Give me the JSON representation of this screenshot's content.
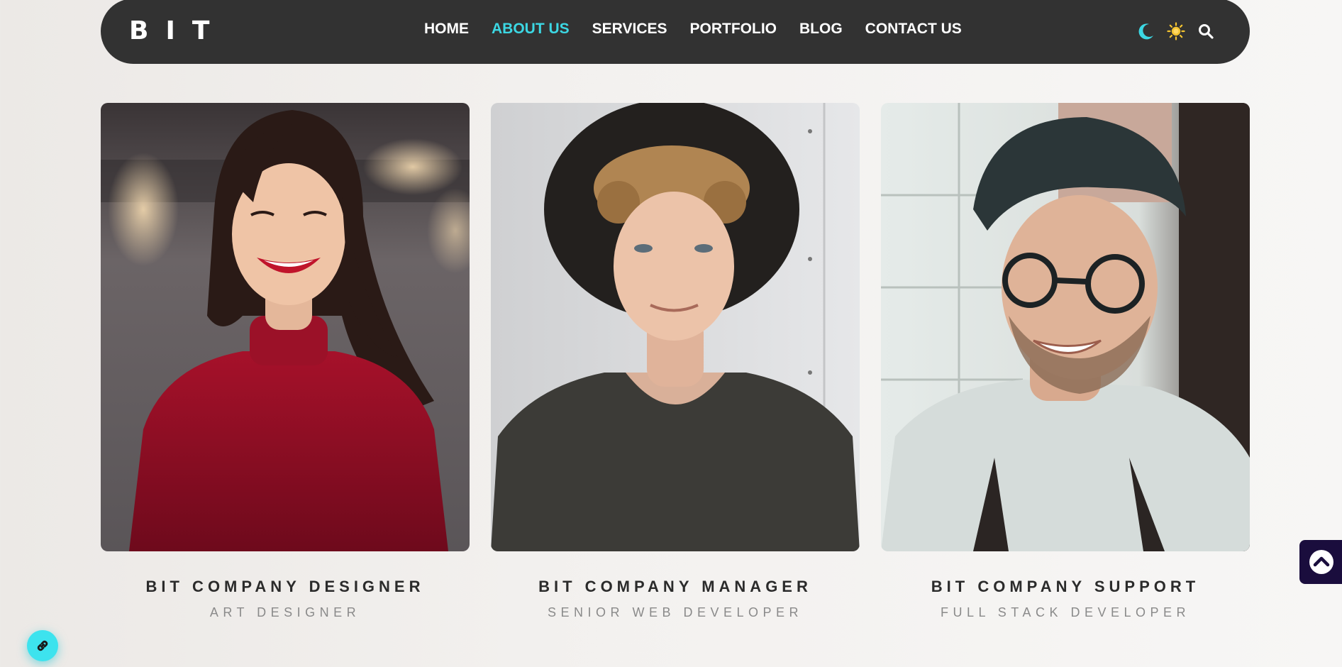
{
  "header": {
    "logo_letters": [
      "B",
      "I",
      "T"
    ],
    "nav": [
      {
        "label": "HOME",
        "active": false
      },
      {
        "label": "ABOUT US",
        "active": true
      },
      {
        "label": "SERVICES",
        "active": false
      },
      {
        "label": "PORTFOLIO",
        "active": false
      },
      {
        "label": "BLOG",
        "active": false
      },
      {
        "label": "CONTACT US",
        "active": false
      }
    ],
    "tools": {
      "dark_mode_icon": "moon-icon",
      "light_mode_icon": "sun-icon",
      "search_icon": "search-icon"
    }
  },
  "team": [
    {
      "name": "BIT COMPANY DESIGNER",
      "role": "ART DESIGNER",
      "photo": "woman-red-sweater-portrait"
    },
    {
      "name": "BIT COMPANY MANAGER",
      "role": "SENIOR WEB DEVELOPER",
      "photo": "man-black-hat-portrait"
    },
    {
      "name": "BIT COMPANY SUPPORT",
      "role": "FULL STACK DEVELOPER",
      "photo": "man-glasses-portrait"
    }
  ],
  "floating": {
    "back_to_top_icon": "chevron-up-circle-icon",
    "link_icon": "link-icon"
  },
  "colors": {
    "accent": "#3cd7e3",
    "navbar": "#323232",
    "back_to_top": "#1a0d3d",
    "sun": "#f4c430"
  }
}
